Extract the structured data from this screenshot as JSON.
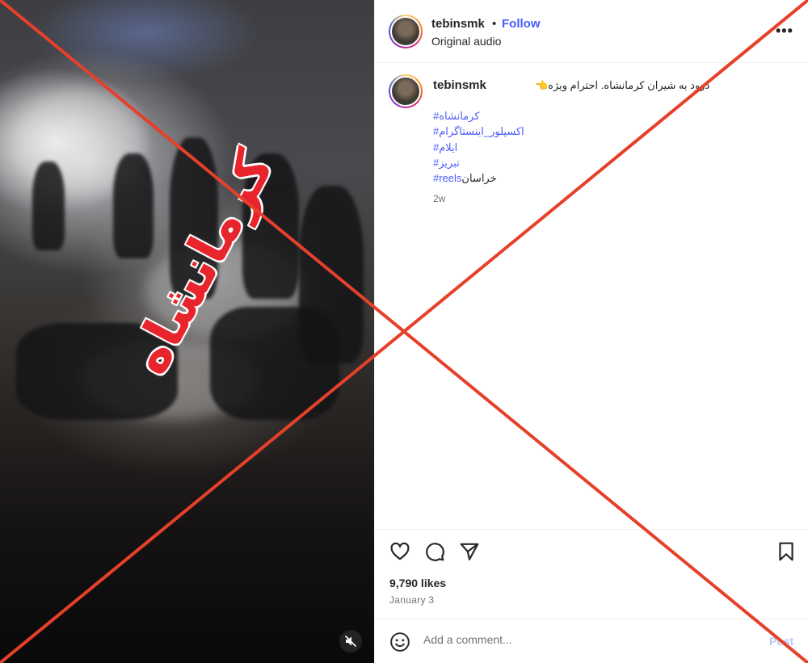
{
  "video": {
    "overlay_text": "کرمانشاه",
    "mute_icon": "speaker-muted-icon"
  },
  "post": {
    "author": {
      "username": "tebinsmk",
      "separator": "•",
      "follow_label": "Follow",
      "audio_label": "Original audio"
    },
    "more_label": "•••",
    "caption": {
      "username": "tebinsmk",
      "text": "درود به شیران کرمانشاه. احترام ویژه👈",
      "hashtags": [
        "#کرمانشاه",
        "#اکسپلور_اینستاگرام",
        "#ایلام",
        "#تبریز",
        "#reels"
      ],
      "last_line_suffix": "خراسان",
      "time_ago": "2w"
    },
    "actions": {
      "like_icon": "heart-icon",
      "comment_icon": "comment-icon",
      "share_icon": "share-icon",
      "save_icon": "bookmark-icon"
    },
    "likes_label": "9,790 likes",
    "date_label": "January 3"
  },
  "comment": {
    "emoji_icon": "emoji-icon",
    "placeholder": "Add a comment...",
    "post_label": "Post"
  },
  "colors": {
    "accent_blue": "#4a5df9",
    "cross_red": "#e6402a",
    "overlay_red": "#e8242c",
    "post_disabled": "#b2c9f7"
  }
}
